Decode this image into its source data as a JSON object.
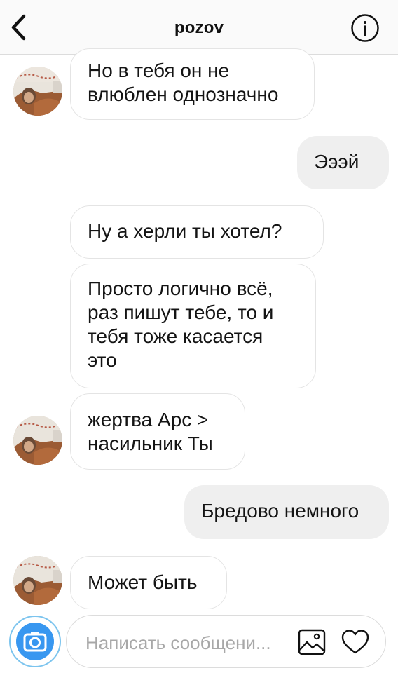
{
  "header": {
    "title": "pozov",
    "back_icon": "chevron-left-icon",
    "info_icon": "info-icon"
  },
  "messages": [
    {
      "side": "in",
      "lines": [
        "Но в тебя он не",
        "влюблен однозначно"
      ],
      "avatar": true
    },
    {
      "side": "out",
      "lines": [
        "Эээй"
      ]
    },
    {
      "side": "in",
      "lines": [
        "Ну а херли ты хотел?"
      ],
      "avatar": false
    },
    {
      "side": "in",
      "lines": [
        "Просто логично всё,",
        "раз пишут тебе, то и",
        "тебя тоже касается",
        "это"
      ],
      "avatar": false
    },
    {
      "side": "in",
      "lines": [
        "жертва Арс >",
        "насильник Ты"
      ],
      "avatar": true
    },
    {
      "side": "out",
      "lines": [
        "Бредово немного"
      ]
    },
    {
      "side": "in",
      "lines": [
        "Может быть"
      ],
      "avatar": true
    }
  ],
  "composer": {
    "placeholder": "Написать сообщени...",
    "camera_icon": "camera-icon",
    "gallery_icon": "gallery-icon",
    "like_icon": "heart-icon"
  },
  "colors": {
    "accent": "#3897f0",
    "incoming_border": "#e4e4e4",
    "outgoing_bg": "#efefef"
  }
}
